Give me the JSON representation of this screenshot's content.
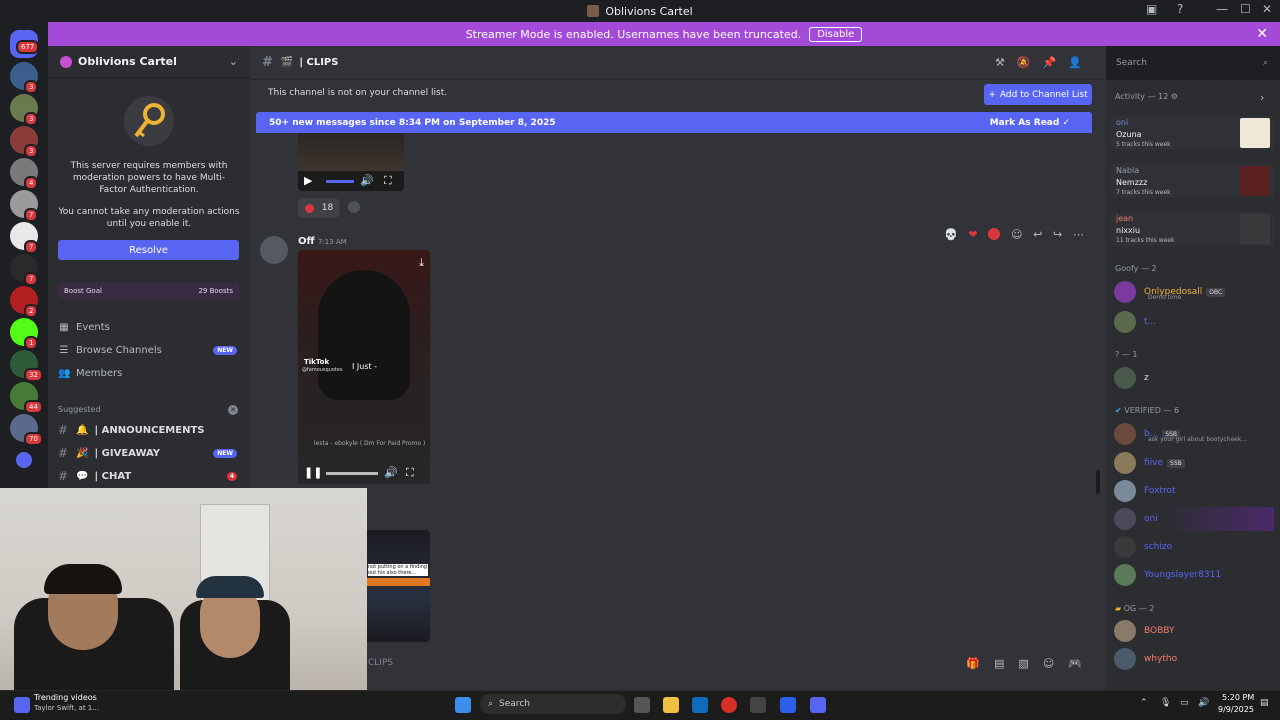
{
  "window": {
    "title": "Oblivions Cartel"
  },
  "banner": {
    "text": "Streamer Mode is enabled. Usernames have been truncated.",
    "button": "Disable"
  },
  "rail": {
    "home_badge": "677",
    "servers": [
      {
        "badge": "3",
        "color": "#3b5e8c"
      },
      {
        "badge": "3",
        "color": "#6a7b4f"
      },
      {
        "badge": "3",
        "color": "#8c3b3b"
      },
      {
        "badge": "4",
        "color": "#7a7a7a"
      },
      {
        "badge": "7",
        "color": "#9a9a9a"
      },
      {
        "badge": "7",
        "color": "#e8e8e8"
      },
      {
        "badge": "7",
        "color": "#2a2a2a"
      },
      {
        "badge": "2",
        "color": "#b02020"
      },
      {
        "badge": "1",
        "color": "#53fc18"
      },
      {
        "badge": "32",
        "color": "#2f5a3a"
      },
      {
        "badge": "44",
        "color": "#4a7a3a"
      },
      {
        "badge": "70",
        "color": "#5a6a8a"
      }
    ]
  },
  "sidebar": {
    "server_name": "Oblivions Cartel",
    "mfa_text_1": "This server requires members with moderation powers to have Multi-Factor Authentication.",
    "mfa_text_2": "You cannot take any moderation actions until you enable it.",
    "resolve_label": "Resolve",
    "boost_goal": "Boost Goal",
    "boost_count": "29 Boosts",
    "nav": [
      {
        "label": "Events",
        "icon": "calendar-icon"
      },
      {
        "label": "Browse Channels",
        "icon": "browse-icon",
        "tag": "NEW"
      },
      {
        "label": "Members",
        "icon": "members-icon"
      }
    ],
    "suggested_label": "Suggested",
    "channels": [
      {
        "label": "| ANNOUNCEMENTS",
        "emoji": "🔔"
      },
      {
        "label": "| GIVEAWAY",
        "emoji": "🎉",
        "tag": "NEW"
      },
      {
        "label": "| CHAT",
        "emoji": "💬",
        "badge": "4"
      }
    ]
  },
  "header": {
    "channel": "| CLIPS"
  },
  "channel_notice": {
    "text": "This channel is not on your channel list.",
    "button": "Add to Channel List"
  },
  "new_messages": {
    "text": "50+ new messages since 8:34 PM on September 8, 2025",
    "action": "Mark As Read"
  },
  "messages": {
    "reaction_count": "18",
    "author": "Off",
    "time": "7:13 AM",
    "video2_overlay_tiktok": "TikTok",
    "video2_overlay_handle": "@famousquotes",
    "video2_overlay_text": "I Just -",
    "video2_caption": "lesta - ebokyle ( Dm For Paid Promo )",
    "video3_caption": "not putting on a finding out his also there..."
  },
  "composer": {
    "placeholder": "CLIPS"
  },
  "search": {
    "placeholder": "Search"
  },
  "members": {
    "activity_header": "Activity — 12",
    "activity": [
      {
        "name": "oni",
        "title": "Ozuna",
        "sub": "5 tracks this week"
      },
      {
        "name": "Nabla",
        "title": "Nemzzz",
        "sub": "7 tracks this week"
      },
      {
        "name": "jean",
        "title": "nixxiu",
        "sub": "11 tracks this week"
      }
    ],
    "groups": [
      {
        "label": "Goofy — 2",
        "items": [
          {
            "name": "Onlypedosall",
            "color": "#f0b232",
            "tag": "OBC",
            "status": "Demo time"
          },
          {
            "name": "t...",
            "color": "#5865f2"
          }
        ]
      },
      {
        "label": "? — 1",
        "items": [
          {
            "name": "z",
            "color": "#dbdee1"
          }
        ]
      },
      {
        "label": "VERIFIED — 6",
        "items": [
          {
            "name": "b...",
            "color": "#5865f2",
            "tag": "SSB",
            "status": "ask your girl about bootycheek..."
          },
          {
            "name": "fiive",
            "color": "#5865f2",
            "tag": "SSB"
          },
          {
            "name": "Foxtrot",
            "color": "#5865f2"
          },
          {
            "name": "oni",
            "color": "#5865f2"
          },
          {
            "name": "schizo",
            "color": "#5865f2"
          },
          {
            "name": "Youngslayer8311",
            "color": "#5865f2"
          }
        ]
      },
      {
        "label": "OG — 2",
        "items": [
          {
            "name": "BOBBY",
            "color": "#f47b67"
          },
          {
            "name": "whytho",
            "color": "#f47b67"
          }
        ]
      }
    ]
  },
  "taskbar": {
    "trending_title": "Trending videos",
    "trending_sub": "Taylor Swift, at 1...",
    "search": "Search",
    "time": "5:20 PM",
    "date": "9/9/2025"
  }
}
